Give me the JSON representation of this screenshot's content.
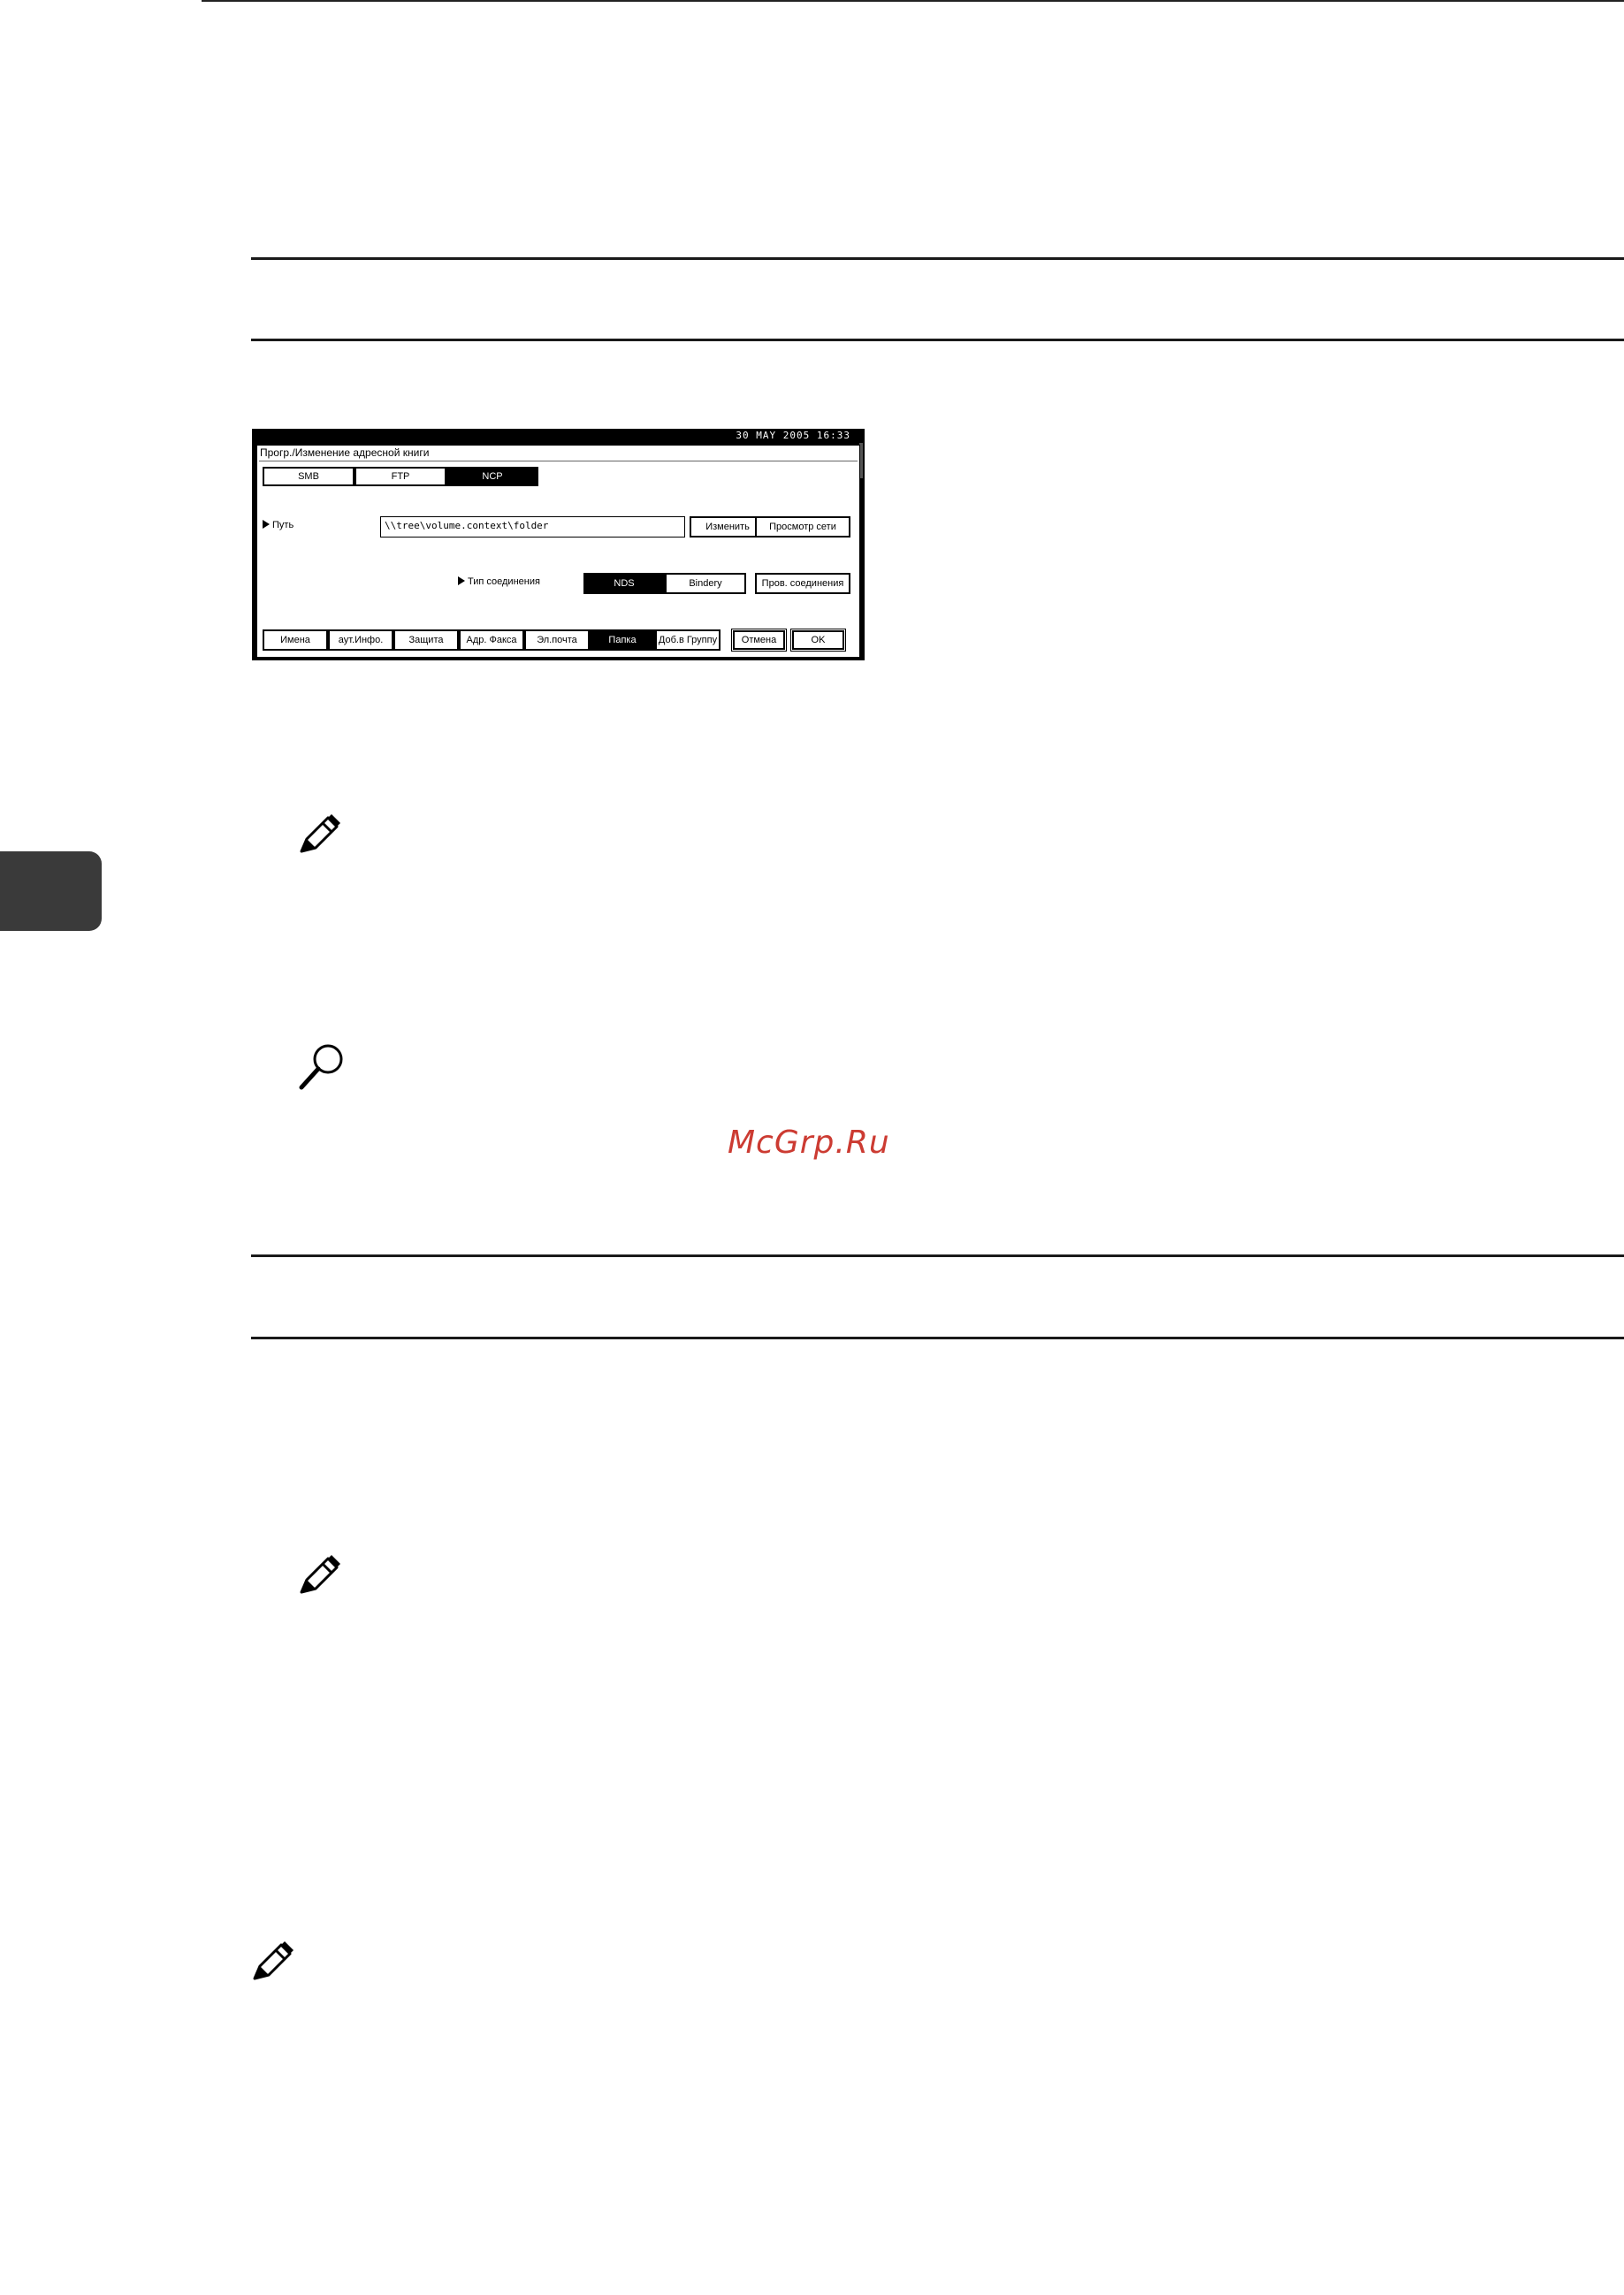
{
  "watermark": "McGrp.Ru",
  "icons": {
    "note_1": "pencil-note-icon",
    "reference": "magnifier-reference-icon",
    "note_2": "pencil-note-icon",
    "note_3": "pencil-note-icon"
  },
  "colors": {
    "watermark": "#cc3b32",
    "side_tab": "#3a3a3a"
  },
  "device_screen": {
    "clock": "30 MAY  2005 16:33",
    "title": "Прогр./Изменение адресной книги",
    "protocol_tabs": [
      {
        "label": "SMB",
        "selected": false
      },
      {
        "label": "FTP",
        "selected": false
      },
      {
        "label": "NCP",
        "selected": true
      }
    ],
    "path_label": "Путь",
    "path_value": "\\\\tree\\volume.context\\folder",
    "change_button": "Изменить",
    "browse_button": "Просмотр сети",
    "connection_label": "Тип соединения",
    "connection_options": [
      {
        "label": "NDS",
        "selected": true
      },
      {
        "label": "Bindery",
        "selected": false
      }
    ],
    "connection_test_button": "Пров. соединения",
    "bottom_tabs": [
      {
        "label": "Имена",
        "selected": false
      },
      {
        "label": "аут.Инфо.",
        "selected": false
      },
      {
        "label": "Защита",
        "selected": false
      },
      {
        "label": "Адр. Факса",
        "selected": false
      },
      {
        "label": "Эл.почта",
        "selected": false
      },
      {
        "label": "Папка",
        "selected": true
      },
      {
        "label": "Доб.в Группу",
        "selected": false
      }
    ],
    "cancel_button": "Отмена",
    "ok_button": "OK"
  }
}
